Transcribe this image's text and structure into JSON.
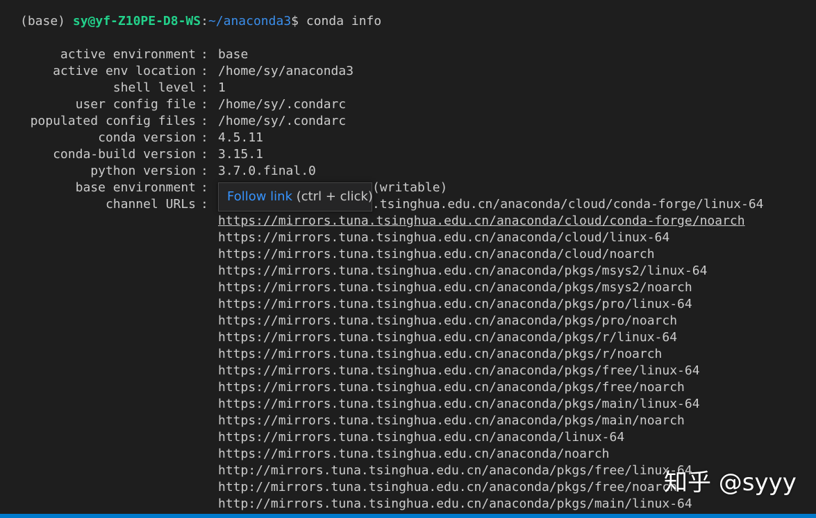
{
  "prompt": {
    "env": "(base)",
    "userhost": "sy@yf-Z10PE-D8-WS",
    "colon": ":",
    "path": "~/anaconda3",
    "symbol": "$",
    "command": "conda info"
  },
  "info": [
    {
      "key": "active environment",
      "value": "base"
    },
    {
      "key": "active env location",
      "value": "/home/sy/anaconda3"
    },
    {
      "key": "shell level",
      "value": "1"
    },
    {
      "key": "user config file",
      "value": "/home/sy/.condarc"
    },
    {
      "key": "populated config files",
      "value": "/home/sy/.condarc"
    },
    {
      "key": "conda version",
      "value": "4.5.11"
    },
    {
      "key": "conda-build version",
      "value": "3.15.1"
    },
    {
      "key": "python version",
      "value": "3.7.0.final.0"
    },
    {
      "key": "base environment",
      "value": "(writable)"
    },
    {
      "key": "channel URLs",
      "value": ".tsinghua.edu.cn/anaconda/cloud/conda-forge/linux-64"
    }
  ],
  "channel_urls": [
    "https://mirrors.tuna.tsinghua.edu.cn/anaconda/cloud/conda-forge/noarch",
    "https://mirrors.tuna.tsinghua.edu.cn/anaconda/cloud/linux-64",
    "https://mirrors.tuna.tsinghua.edu.cn/anaconda/cloud/noarch",
    "https://mirrors.tuna.tsinghua.edu.cn/anaconda/pkgs/msys2/linux-64",
    "https://mirrors.tuna.tsinghua.edu.cn/anaconda/pkgs/msys2/noarch",
    "https://mirrors.tuna.tsinghua.edu.cn/anaconda/pkgs/pro/linux-64",
    "https://mirrors.tuna.tsinghua.edu.cn/anaconda/pkgs/pro/noarch",
    "https://mirrors.tuna.tsinghua.edu.cn/anaconda/pkgs/r/linux-64",
    "https://mirrors.tuna.tsinghua.edu.cn/anaconda/pkgs/r/noarch",
    "https://mirrors.tuna.tsinghua.edu.cn/anaconda/pkgs/free/linux-64",
    "https://mirrors.tuna.tsinghua.edu.cn/anaconda/pkgs/free/noarch",
    "https://mirrors.tuna.tsinghua.edu.cn/anaconda/pkgs/main/linux-64",
    "https://mirrors.tuna.tsinghua.edu.cn/anaconda/pkgs/main/noarch",
    "https://mirrors.tuna.tsinghua.edu.cn/anaconda/linux-64",
    "https://mirrors.tuna.tsinghua.edu.cn/anaconda/noarch",
    "http://mirrors.tuna.tsinghua.edu.cn/anaconda/pkgs/free/linux-64",
    "http://mirrors.tuna.tsinghua.edu.cn/anaconda/pkgs/free/noarch",
    "http://mirrors.tuna.tsinghua.edu.cn/anaconda/pkgs/main/linux-64"
  ],
  "tooltip": {
    "link_text": "Follow link",
    "hint": "(ctrl + click)"
  },
  "watermark": "知乎 @syyy",
  "colors": {
    "background": "#1e1e1e",
    "text": "#cccccc",
    "userhost": "#23d18b",
    "path": "#3b8eea",
    "tooltip_link": "#3794ff",
    "statusbar": "#007acc"
  }
}
